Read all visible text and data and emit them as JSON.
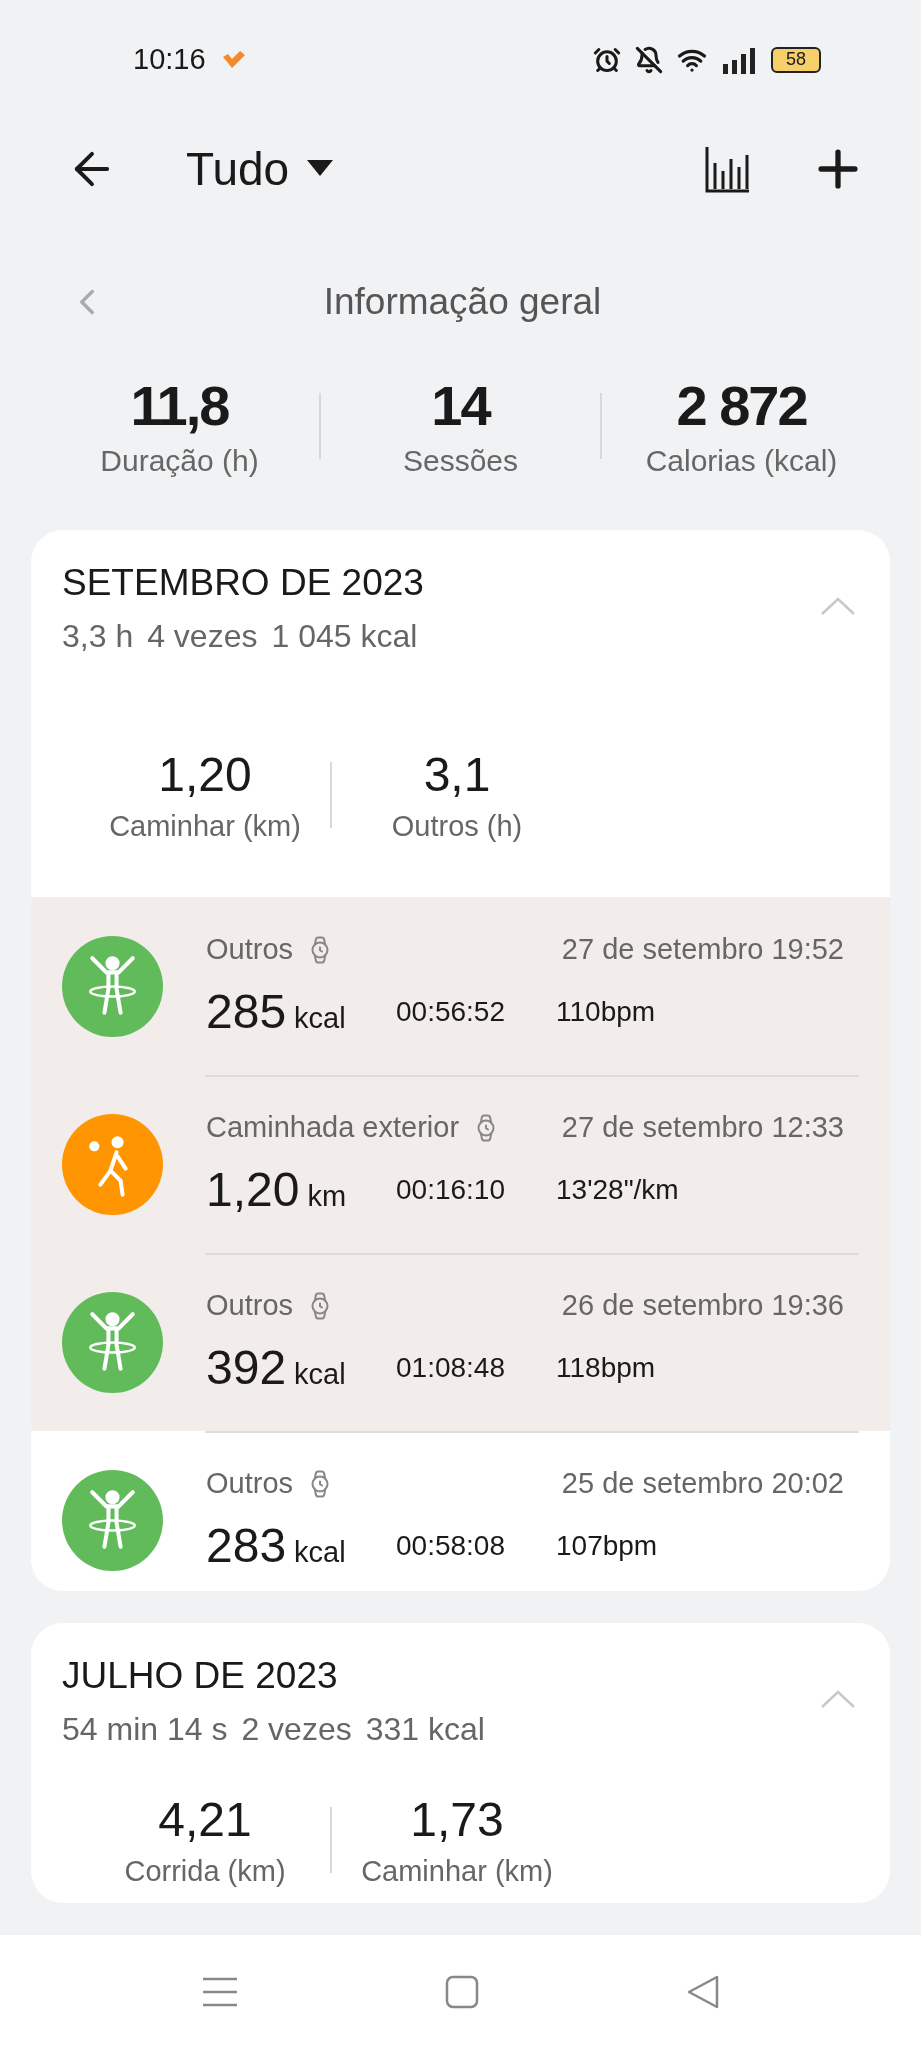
{
  "status_bar": {
    "time": "10:16",
    "battery": "58"
  },
  "header": {
    "title": "Tudo"
  },
  "overview": {
    "title": "Informação geral",
    "stats": [
      {
        "value": "11,8",
        "label": "Duração (h)"
      },
      {
        "value": "14",
        "label": "Sessões"
      },
      {
        "value": "2 872",
        "label": "Calorias (kcal)"
      }
    ]
  },
  "months": [
    {
      "title": "SETEMBRO DE 2023",
      "summary": [
        "3,3 h",
        "4 vezes",
        "1 045 kcal"
      ],
      "expanded": true,
      "stats": [
        {
          "value": "1,20",
          "label": "Caminhar (km)"
        },
        {
          "value": "3,1",
          "label": "Outros (h)"
        }
      ],
      "sessions": [
        {
          "kind": "other",
          "name": "Outros",
          "datetime": "27 de setembro 19:52",
          "value": "285",
          "unit": "kcal",
          "duration": "00:56:52",
          "metric": "110bpm",
          "highlighted": true
        },
        {
          "kind": "walk",
          "name": "Caminhada exterior",
          "datetime": "27 de setembro 12:33",
          "value": "1,20",
          "unit": "km",
          "duration": "00:16:10",
          "metric": "13'28\"/km",
          "highlighted": true
        },
        {
          "kind": "other",
          "name": "Outros",
          "datetime": "26 de setembro 19:36",
          "value": "392",
          "unit": "kcal",
          "duration": "01:08:48",
          "metric": "118bpm",
          "highlighted": true
        },
        {
          "kind": "other",
          "name": "Outros",
          "datetime": "25 de setembro 20:02",
          "value": "283",
          "unit": "kcal",
          "duration": "00:58:08",
          "metric": "107bpm",
          "highlighted": false
        }
      ]
    },
    {
      "title": "JULHO DE 2023",
      "summary": [
        "54 min 14 s",
        "2 vezes",
        "331 kcal"
      ],
      "expanded": true,
      "stats": [
        {
          "value": "4,21",
          "label": "Corrida (km)"
        },
        {
          "value": "1,73",
          "label": "Caminhar (km)"
        }
      ]
    }
  ]
}
